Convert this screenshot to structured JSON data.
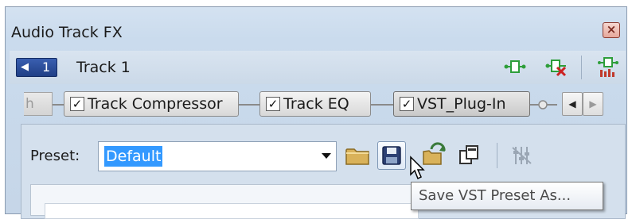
{
  "window": {
    "title": "Audio Track FX",
    "close_glyph": "×"
  },
  "track": {
    "number": "1",
    "name": "Track 1",
    "icons": [
      "plugin-chain-icon",
      "remove-plugin-icon",
      "plugin-chooser-icon"
    ]
  },
  "chain": {
    "plugins": [
      {
        "label": "Track Compressor",
        "checked": true,
        "selected": false
      },
      {
        "label": "Track EQ",
        "checked": true,
        "selected": false
      },
      {
        "label": "VST_Plug-In",
        "checked": true,
        "selected": true
      }
    ],
    "stub_text": "h",
    "nav": {
      "prev_glyph": "◀",
      "next_glyph": "▶"
    }
  },
  "preset": {
    "label": "Preset:",
    "value": "Default"
  },
  "toolbar": {
    "icons": [
      "open-folder-icon",
      "save-preset-icon",
      "update-preset-icon",
      "copy-preset-icon",
      "bypass-icon"
    ]
  },
  "tooltip": {
    "text": "Save VST Preset As..."
  },
  "colors": {
    "accent": "#3399ff",
    "badge": "#203f86",
    "remove_red": "#cc2222",
    "plug_green": "#2e9e3a"
  }
}
